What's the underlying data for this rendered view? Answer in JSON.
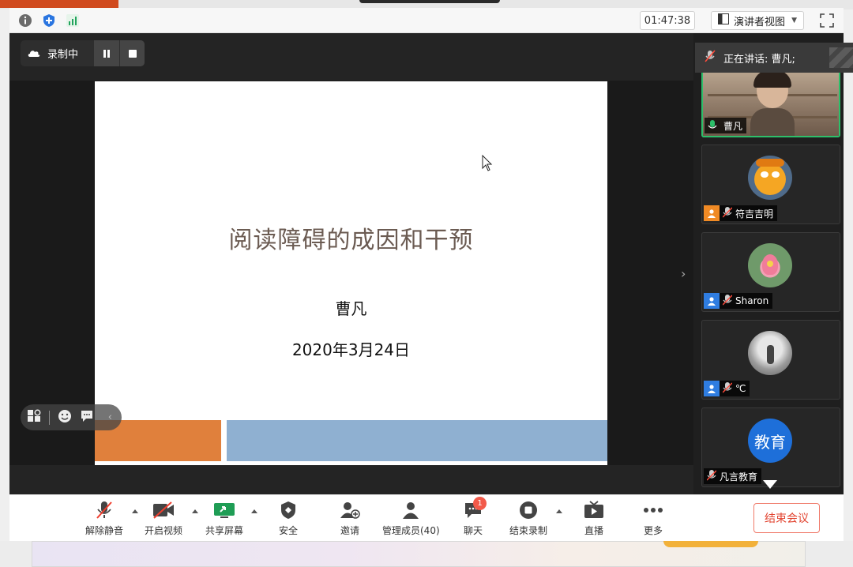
{
  "topbar": {
    "timer": "01:47:38",
    "view_label": "演讲者视图",
    "icons": [
      "info-icon",
      "shield-icon",
      "signal-icon",
      "fullscreen-icon"
    ]
  },
  "recording": {
    "label": "录制中"
  },
  "slide": {
    "title": "阅读障碍的成因和干预",
    "author": "曹凡",
    "date": "2020年3月24日",
    "colors": {
      "orange": "#e0803c",
      "blue": "#8fb0d1",
      "title": "#6b5b52"
    }
  },
  "speaking": {
    "label": "正在讲话: 曹凡;"
  },
  "participants": [
    {
      "name": "曹凡",
      "type": "video",
      "mic": "on"
    },
    {
      "name": "符吉吉明",
      "type": "avatar",
      "avatar": "orange-toy",
      "mic": "muted",
      "user_color": "#f08a24"
    },
    {
      "name": "Sharon",
      "type": "avatar",
      "avatar": "lotus",
      "mic": "muted",
      "user_color": "#2f7de1"
    },
    {
      "name": "℃",
      "type": "avatar",
      "avatar": "photo-gray",
      "mic": "muted",
      "user_color": "#2f7de1"
    },
    {
      "name": "凡言教育",
      "type": "text-avatar",
      "avatar_text": "教育",
      "mic": "muted"
    }
  ],
  "toolbar": {
    "unmute": "解除静音",
    "start_video": "开启视频",
    "share_screen": "共享屏幕",
    "security": "安全",
    "invite": "邀请",
    "manage_members": "管理成员(40)",
    "chat": "聊天",
    "chat_badge": "1",
    "end_recording": "结束录制",
    "live": "直播",
    "more": "更多",
    "end_meeting": "结束会议"
  }
}
